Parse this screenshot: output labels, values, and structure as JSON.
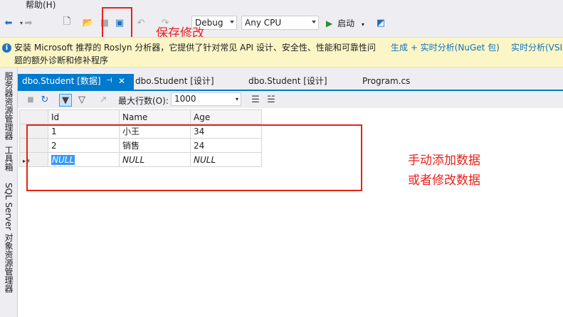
{
  "menu": {
    "help": "帮助(H)"
  },
  "toolbar": {
    "config_value": "Debug",
    "platform_value": "Any CPU",
    "start_label": "启动"
  },
  "annotations": {
    "save_changes": "保存修改",
    "add_or_modify_line1": "手动添加数据",
    "add_or_modify_line2": "或者修改数据",
    "highlight_color": "#e8221b"
  },
  "infobar": {
    "message_line1": "安装 Microsoft 推荐的 Roslyn 分析器，它提供了针对常见 API 设计、安全性、性能和可靠性问",
    "message_line2": "题的额外诊断和修补程序",
    "link_generate": "生成 + 实时分析(NuGet 包)",
    "link_realtime": "实时分析(VSIX"
  },
  "sidebar": {
    "items": [
      {
        "label": "服务器资源管理器"
      },
      {
        "label": "工具箱"
      },
      {
        "label": "SQL Server 对象资源管理器"
      }
    ]
  },
  "tabs": [
    {
      "label": "dbo.Student [数据]",
      "active": true
    },
    {
      "label": "dbo.Student [设计]",
      "active": false
    },
    {
      "label": "dbo.Student [设计]",
      "active": false
    },
    {
      "label": "Program.cs",
      "active": false
    }
  ],
  "docbar": {
    "max_rows_label": "最大行数(O):",
    "max_rows_value": "1000"
  },
  "grid": {
    "columns": [
      "Id",
      "Name",
      "Age"
    ],
    "rows": [
      [
        "1",
        "小王",
        "34"
      ],
      [
        "2",
        "销售",
        "24"
      ],
      [
        "NULL",
        "NULL",
        "NULL"
      ]
    ]
  },
  "colors": {
    "accent": "#007acc",
    "infobar_bg": "#fcf6c6"
  }
}
